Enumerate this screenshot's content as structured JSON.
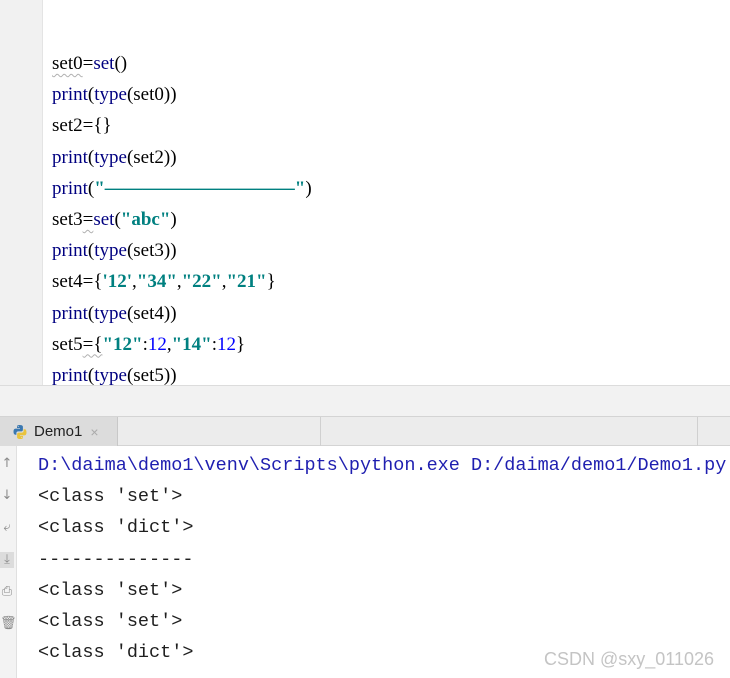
{
  "editor": {
    "lines": [
      [
        {
          "t": "set0",
          "c": "def",
          "w": true
        },
        {
          "t": "=",
          "c": "def"
        },
        {
          "t": "set",
          "c": "kw"
        },
        {
          "t": "()",
          "c": "def"
        }
      ],
      [
        {
          "t": "print",
          "c": "kw"
        },
        {
          "t": "(",
          "c": "def"
        },
        {
          "t": "type",
          "c": "kw"
        },
        {
          "t": "(set0))",
          "c": "def"
        }
      ],
      [
        {
          "t": "set2",
          "c": "def"
        },
        {
          "t": "={}",
          "c": "def"
        }
      ],
      [
        {
          "t": "print",
          "c": "kw"
        },
        {
          "t": "(",
          "c": "def"
        },
        {
          "t": "type",
          "c": "kw"
        },
        {
          "t": "(set2))",
          "c": "def"
        }
      ],
      [
        {
          "t": "print",
          "c": "kw"
        },
        {
          "t": "(",
          "c": "def"
        },
        {
          "t": "\"——————————\"",
          "c": "str"
        },
        {
          "t": ")",
          "c": "def"
        }
      ],
      [
        {
          "t": "set3",
          "c": "def"
        },
        {
          "t": "=",
          "c": "def",
          "w": true
        },
        {
          "t": "set",
          "c": "kw"
        },
        {
          "t": "(",
          "c": "def"
        },
        {
          "t": "\"abc\"",
          "c": "str"
        },
        {
          "t": ")",
          "c": "def"
        }
      ],
      [
        {
          "t": "print",
          "c": "kw"
        },
        {
          "t": "(",
          "c": "def"
        },
        {
          "t": "type",
          "c": "kw"
        },
        {
          "t": "(set3))",
          "c": "def"
        }
      ],
      [
        {
          "t": "set4",
          "c": "def"
        },
        {
          "t": "={",
          "c": "def"
        },
        {
          "t": "'12'",
          "c": "str"
        },
        {
          "t": ",",
          "c": "def"
        },
        {
          "t": "\"34\"",
          "c": "str"
        },
        {
          "t": ",",
          "c": "def"
        },
        {
          "t": "\"22\"",
          "c": "str"
        },
        {
          "t": ",",
          "c": "def"
        },
        {
          "t": "\"21\"",
          "c": "str"
        },
        {
          "t": "}",
          "c": "def"
        }
      ],
      [
        {
          "t": "print",
          "c": "kw"
        },
        {
          "t": "(",
          "c": "def"
        },
        {
          "t": "type",
          "c": "kw"
        },
        {
          "t": "(set4))",
          "c": "def"
        }
      ],
      [
        {
          "t": "set5",
          "c": "def"
        },
        {
          "t": "={",
          "c": "def",
          "w": true
        },
        {
          "t": "\"12\"",
          "c": "str"
        },
        {
          "t": ":",
          "c": "def"
        },
        {
          "t": "12",
          "c": "num"
        },
        {
          "t": ",",
          "c": "def"
        },
        {
          "t": "\"14\"",
          "c": "str"
        },
        {
          "t": ":",
          "c": "def"
        },
        {
          "t": "12",
          "c": "num"
        },
        {
          "t": "}",
          "c": "def"
        }
      ],
      [
        {
          "t": "print",
          "c": "kw"
        },
        {
          "t": "(",
          "c": "def"
        },
        {
          "t": "type",
          "c": "kw"
        },
        {
          "t": "(set5))",
          "c": "def"
        }
      ]
    ]
  },
  "run_tab": {
    "label": "Demo1",
    "close": "×"
  },
  "console": {
    "lines": [
      "D:\\daima\\demo1\\venv\\Scripts\\python.exe D:/daima/demo1/Demo1.py",
      "<class 'set'>",
      "<class 'dict'>",
      "--------------",
      "<class 'set'>",
      "<class 'set'>",
      "<class 'dict'>"
    ]
  },
  "gutter_icons": [
    "arrow-up-icon",
    "arrow-down-icon",
    "soft-wrap-icon",
    "scroll-to-end-icon",
    "print-icon",
    "trash-icon"
  ],
  "watermark": "CSDN @sxy_011026",
  "colors": {
    "keyword": "#000080",
    "string": "#008080",
    "number": "#0000ff",
    "path": "#1f1fb0"
  }
}
